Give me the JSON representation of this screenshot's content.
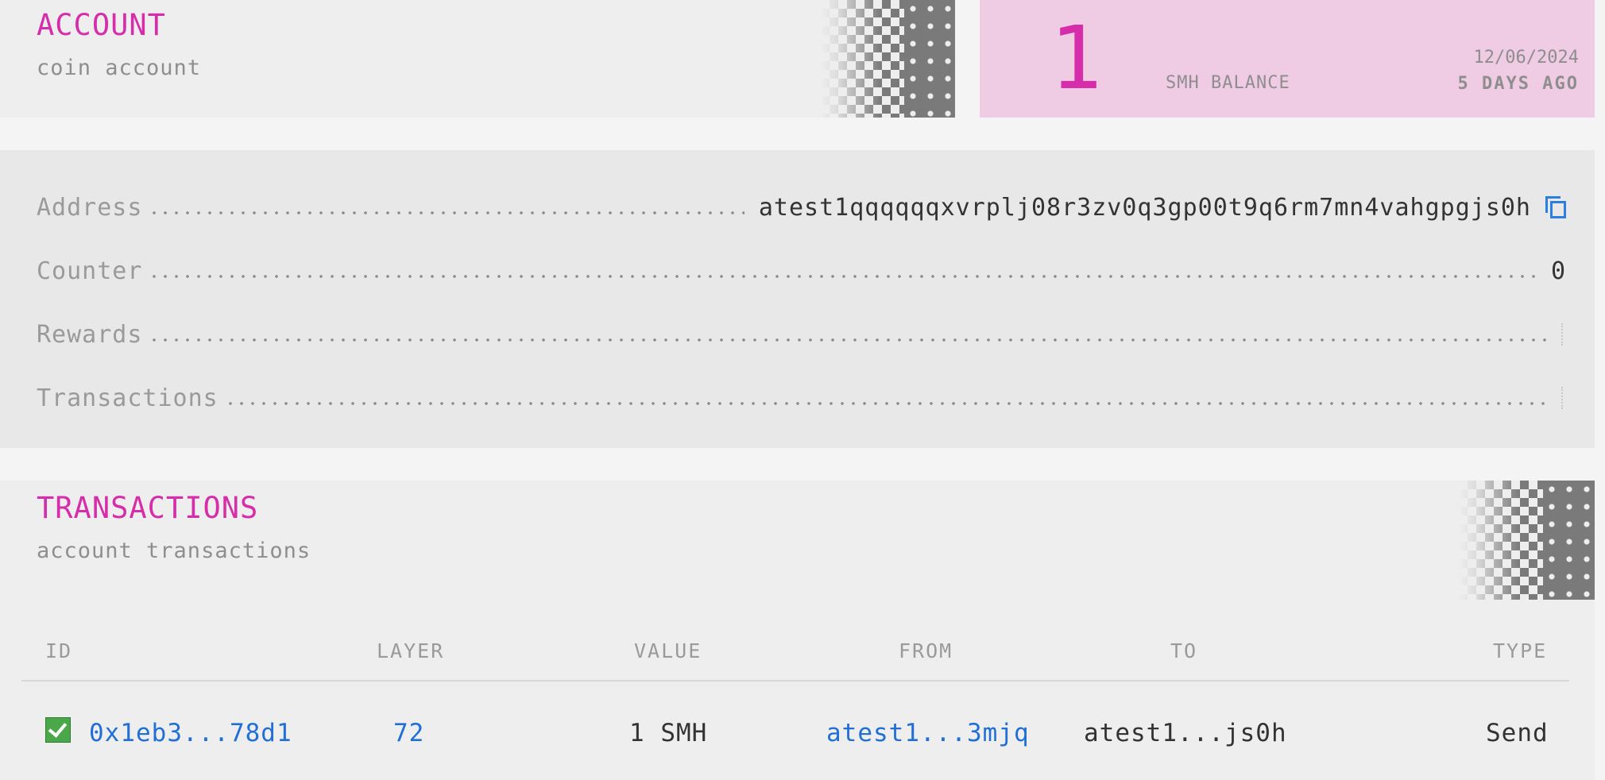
{
  "account": {
    "title": "ACCOUNT",
    "subtitle": "coin account"
  },
  "balance": {
    "amount": "1",
    "label": "SMH BALANCE",
    "date": "12/06/2024",
    "ago": "5 DAYS AGO"
  },
  "details": [
    {
      "label": "Address",
      "value": "atest1qqqqqqxvrplj08r3zv0q3gp00t9q6rm7mn4vahgpgjs0h"
    },
    {
      "label": "Counter",
      "value": "0"
    },
    {
      "label": "Rewards",
      "value": ""
    },
    {
      "label": "Transactions",
      "value": ""
    }
  ],
  "transactions": {
    "title": "TRANSACTIONS",
    "subtitle": "account transactions",
    "columns": [
      "ID",
      "LAYER",
      "VALUE",
      "FROM",
      "TO",
      "TYPE"
    ],
    "rows": [
      {
        "status_icon": "check-icon",
        "id": "0x1eb3...78d1",
        "layer": "72",
        "value": "1 SMH",
        "from": "atest1...3mjq",
        "to": "atest1...js0h",
        "type": "Send"
      }
    ]
  },
  "colors": {
    "accent": "#d62eaa",
    "balance_bg": "#efcbe4",
    "link": "#1f6fd6",
    "success": "#4aa84a"
  },
  "icons": {
    "copy": "copy-icon",
    "status": "check-icon"
  }
}
